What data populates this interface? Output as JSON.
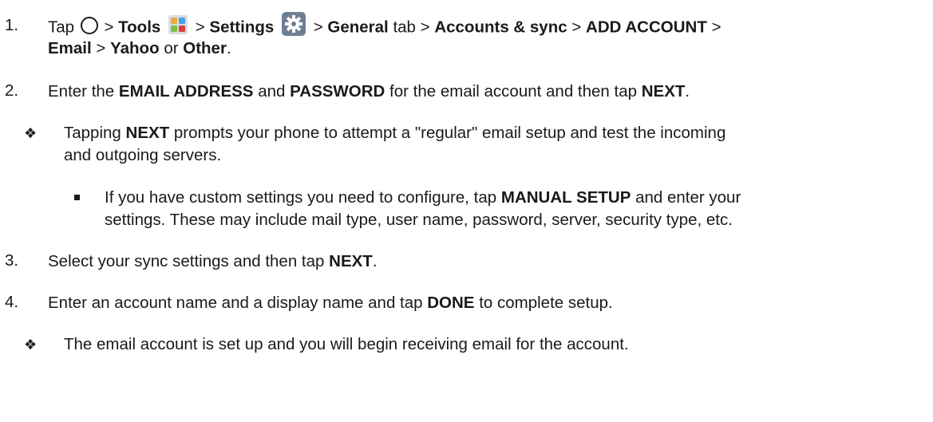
{
  "steps": [
    {
      "number": "1.",
      "line1": {
        "tap": "Tap",
        "sep1": ">",
        "tools": "Tools",
        "sep2": ">",
        "settings": "Settings",
        "sep3": ">",
        "general": "General",
        "tab": "tab >",
        "accounts": "Accounts & sync",
        "sep4": ">",
        "add_account": "ADD ACCOUNT",
        "sep5": ">"
      },
      "line2": {
        "email": "Email",
        "sep": ">",
        "yahoo": "Yahoo",
        "or": "or",
        "other": "Other",
        "end": "."
      }
    },
    {
      "number": "2.",
      "pre": "Enter the",
      "email_address": "EMAIL ADDRESS",
      "and": "and",
      "password": "PASSWORD",
      "mid": "for the email account and then tap",
      "next": "NEXT",
      "end": "."
    },
    {
      "number": "3.",
      "pre": "Select your sync settings and then tap",
      "next": "NEXT",
      "end": "."
    },
    {
      "number": "4.",
      "pre": "Enter an account name and a display name and tap",
      "done": "DONE",
      "post": "to complete setup."
    }
  ],
  "notes": {
    "tapping_next": {
      "pre": "Tapping",
      "next": "NEXT",
      "post_line1": "prompts your phone to attempt a \"regular\" email setup and test the incoming",
      "line2": "and outgoing servers."
    },
    "manual_setup": {
      "pre": "If you have custom settings you need to configure, tap",
      "manual": "MANUAL SETUP",
      "post_line1": "and enter your",
      "line2": "settings. These may include mail type, user name, password, server, security type, etc."
    },
    "setup_complete": {
      "text": "The email account is set up and you will begin receiving email for the account."
    }
  },
  "icons": {
    "home": "home-circle-icon",
    "tools": "tools-folder-icon",
    "settings": "settings-gear-icon"
  }
}
